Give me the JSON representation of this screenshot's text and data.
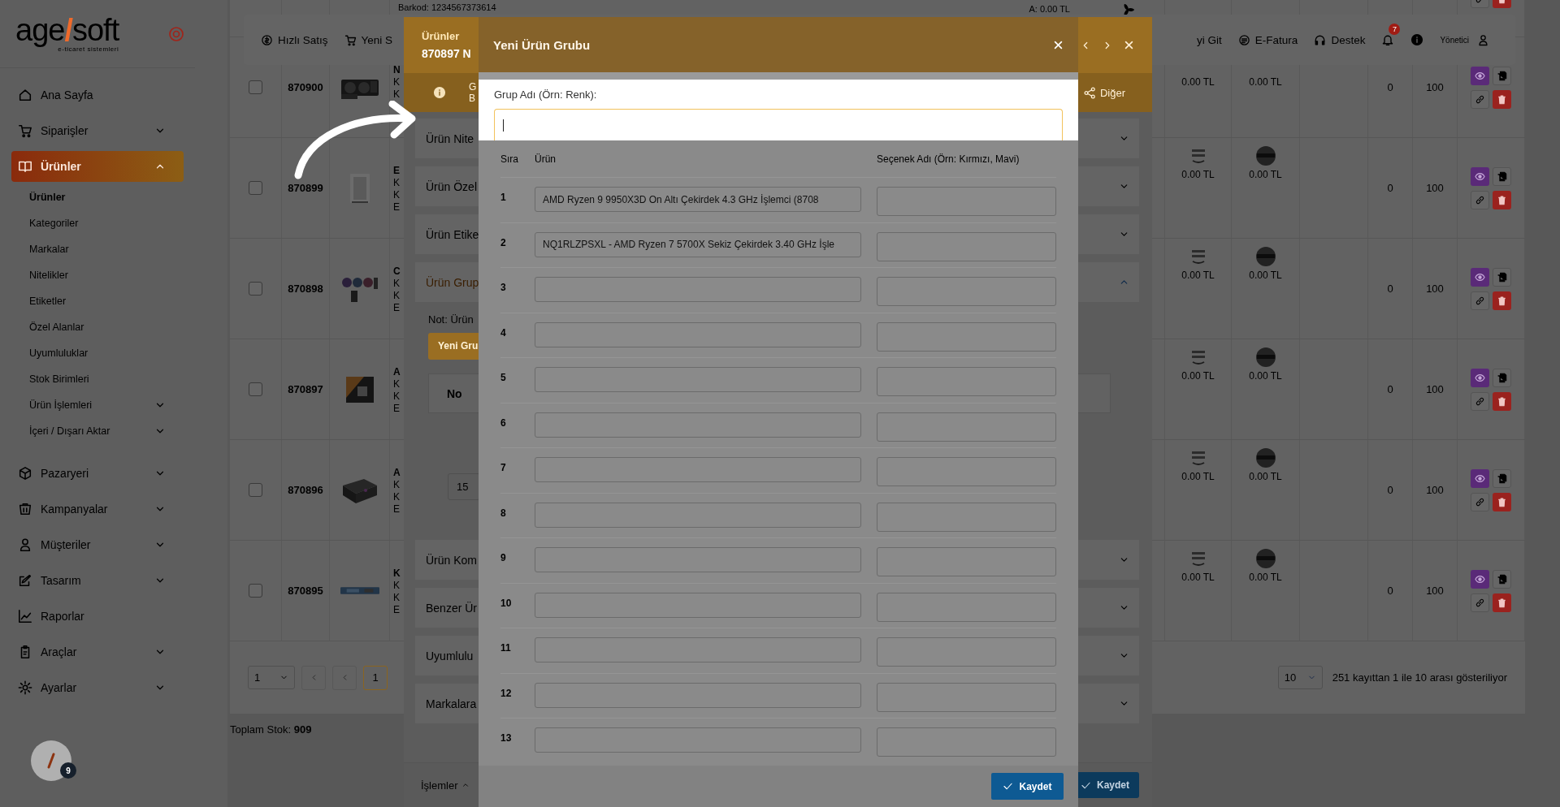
{
  "sidebar": {
    "logo": {
      "parts": [
        "age",
        "/",
        "soft"
      ],
      "tagline": "e-ticaret sistemleri"
    },
    "items": [
      {
        "label": "Ana Sayfa",
        "selected": false
      },
      {
        "label": "Siparişler",
        "expanded": false,
        "selected": false
      },
      {
        "label": "Ürünler",
        "expanded": true,
        "selected": true,
        "children": [
          {
            "label": "Ürünler",
            "selected": true
          },
          {
            "label": "Kategoriler",
            "selected": false
          },
          {
            "label": "Markalar",
            "selected": false
          },
          {
            "label": "Nitelikler",
            "selected": false
          },
          {
            "label": "Etiketler",
            "selected": false
          },
          {
            "label": "Özel Alanlar",
            "selected": false
          },
          {
            "label": "Uyumluluklar",
            "selected": false
          },
          {
            "label": "Stok Birimleri",
            "selected": false
          },
          {
            "label": "Ürün İşlemleri",
            "expanded": false,
            "selected": false
          },
          {
            "label": "İçeri / Dışarı Aktar",
            "expanded": false,
            "selected": false
          }
        ]
      },
      {
        "label": "Pazaryeri",
        "expanded": false,
        "selected": false
      },
      {
        "label": "Kampanyalar",
        "expanded": false,
        "selected": false
      },
      {
        "label": "Müşteriler",
        "expanded": false,
        "selected": false
      },
      {
        "label": "Tasarım",
        "expanded": false,
        "selected": false
      },
      {
        "label": "Raporlar",
        "selected": false
      },
      {
        "label": "Araçlar",
        "expanded": false,
        "selected": false
      },
      {
        "label": "Ayarlar",
        "expanded": false,
        "selected": false
      }
    ]
  },
  "topbar": {
    "left": [
      "Hızlı Satış",
      "Yeni S"
    ],
    "right": [
      "yi Git",
      "E-Fatura",
      "Destek"
    ],
    "notifications": "7",
    "user": "Yönetici"
  },
  "table": {
    "partial_row": {
      "barcode": "Barkod: 1234567373614",
      "price": "A: 0.00 TL"
    },
    "rows": [
      {
        "id": "870900",
        "lines": [
          "N",
          "K",
          "K"
        ],
        "prices": [
          "0.00 TL",
          "0.00 TL"
        ],
        "stock": "0",
        "quantity": "100",
        "checked": false
      },
      {
        "id": "870899",
        "lines": [
          "E",
          "K",
          "K",
          "E"
        ],
        "prices": [
          "0.00 TL",
          "0.00 TL"
        ],
        "stock": "0",
        "quantity": "100",
        "checked": false
      },
      {
        "id": "870898",
        "lines": [
          "C",
          "K",
          "K",
          "E"
        ],
        "prices": [
          "0.00 TL",
          "0.00 TL"
        ],
        "stock": "0",
        "quantity": "100",
        "checked": false
      },
      {
        "id": "870897",
        "lines": [
          "A",
          "K",
          "K",
          "E"
        ],
        "prices": [
          "0.00 TL",
          "0.00 TL"
        ],
        "stock": "0",
        "quantity": "100",
        "checked": false
      },
      {
        "id": "870896",
        "lines": [
          "A",
          "K",
          "K",
          "E"
        ],
        "prices": [
          "0.00 TL",
          "0.00 TL"
        ],
        "stock": "0",
        "quantity": "100",
        "checked": false
      },
      {
        "id": "870895",
        "lines": [
          "K",
          "K",
          "K",
          "E"
        ],
        "prices": [
          "0.00 TL",
          "0.00 TL"
        ],
        "stock": "0",
        "quantity": "100",
        "checked": false
      }
    ]
  },
  "pagination": {
    "page_select": "1",
    "pages": [
      {
        "label": "1",
        "selected": true
      }
    ],
    "page_size": "10",
    "summary": "251 kayıttan 1 ile 10 arası gösteriliyor"
  },
  "total_stock": "Toplam Stok: **909**",
  "drawer": {
    "title": "Ürünler",
    "subtitle": "870897 N",
    "tab_lines": [
      "G",
      "B"
    ],
    "other_tab": "Diğer",
    "sections": [
      {
        "label": "Ürün Nite",
        "expanded": false
      },
      {
        "label": "Ürün Özel",
        "expanded": false
      },
      {
        "label": "Ürün Etike",
        "expanded": false
      },
      {
        "label": "Ürün Grup",
        "expanded": true,
        "note": "Not: Ürün",
        "button": "Yeni Gru",
        "table_header": "No",
        "page_size": "15"
      },
      {
        "label": "Ürün Kom",
        "expanded": false
      },
      {
        "label": "Benzer Ür",
        "expanded": false
      },
      {
        "label": "Uyumlulu",
        "expanded": false
      },
      {
        "label": "Markalara",
        "expanded": false
      }
    ],
    "actions": "İşlemler",
    "save": "Kaydet"
  },
  "modal": {
    "title": "Yeni Ürün Grubu",
    "group_name": {
      "label": "Grup Adı (Örn: Renk):",
      "focused": true
    },
    "columns": [
      "Sıra",
      "Ürün",
      "Seçenek Adı (Örn: Kırmızı, Mavi)"
    ],
    "rows": [
      {
        "index": "1",
        "product": "AMD Ryzen 9 9950X3D On Altı Çekirdek 4.3 GHz İşlemci (8708"
      },
      {
        "index": "2",
        "product": "NQ1RLZPSXL - AMD Ryzen 7 5700X Sekiz Çekirdek 3.40 GHz İşle"
      },
      {
        "index": "3"
      },
      {
        "index": "4"
      },
      {
        "index": "5"
      },
      {
        "index": "6"
      },
      {
        "index": "7"
      },
      {
        "index": "8"
      },
      {
        "index": "9"
      },
      {
        "index": "10"
      },
      {
        "index": "11"
      },
      {
        "index": "12"
      },
      {
        "index": "13"
      }
    ],
    "save": "Kaydet"
  },
  "chat_button": {
    "badge": "9"
  }
}
